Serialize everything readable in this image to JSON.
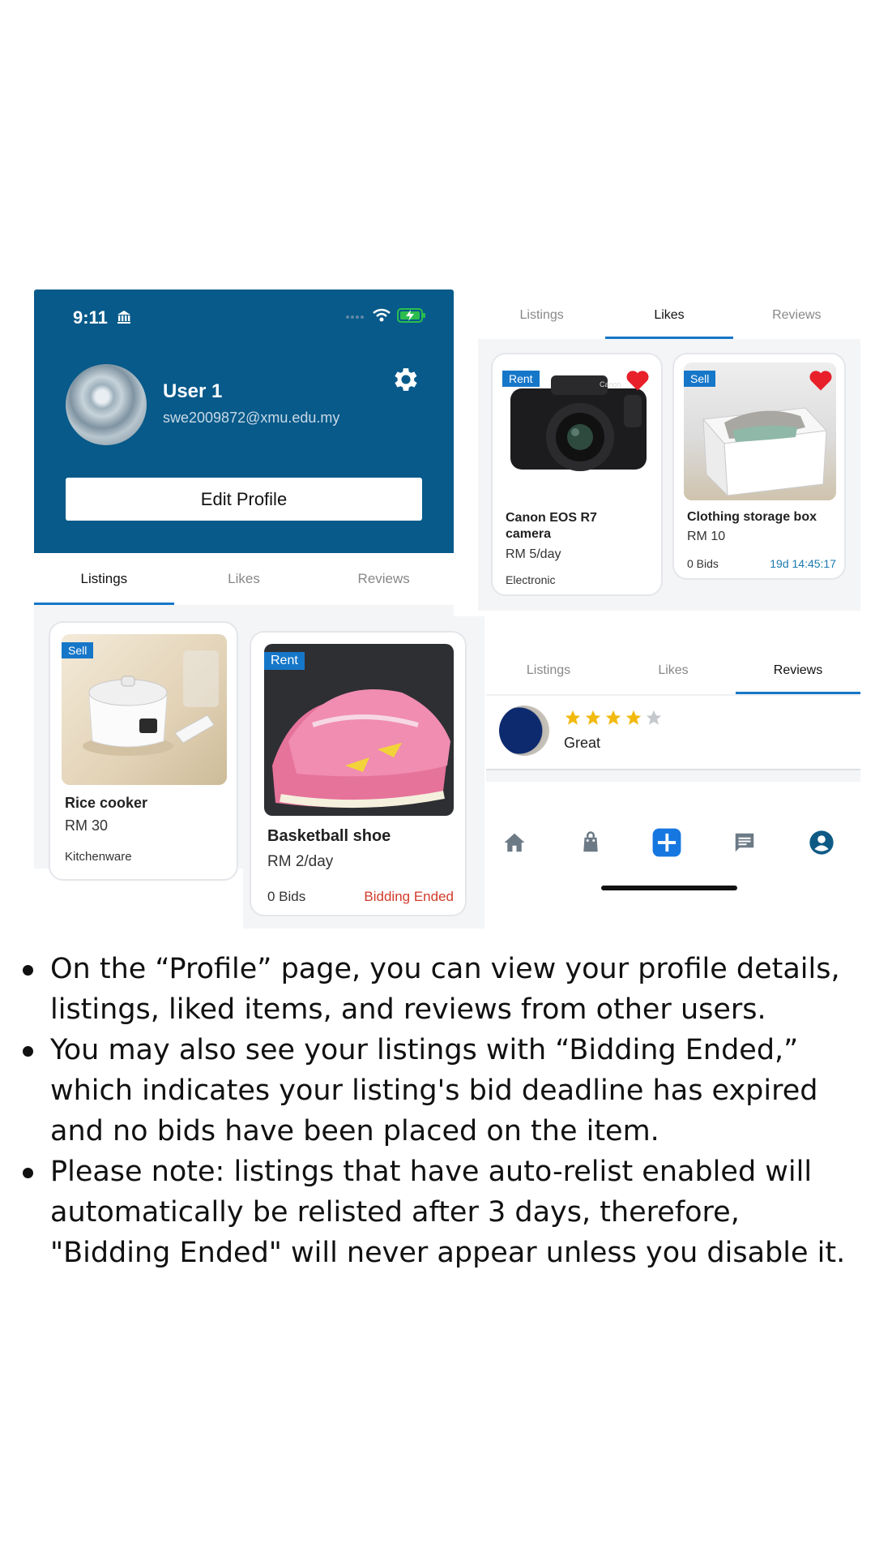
{
  "profile": {
    "status_time": "9:11",
    "user_name": "User 1",
    "user_email": "swe2009872@xmu.edu.my",
    "edit_profile_label": "Edit Profile"
  },
  "tabs": [
    "Listings",
    "Likes",
    "Reviews"
  ],
  "listings": [
    {
      "badge": "Sell",
      "title": "Rice cooker",
      "price": "RM 30",
      "category": "Kitchenware"
    },
    {
      "badge": "Rent",
      "title": "Basketball shoe",
      "price": "RM 2/day",
      "bids": "0 Bids",
      "status": "Bidding Ended"
    }
  ],
  "likes": [
    {
      "badge": "Rent",
      "title": "Canon EOS R7 camera",
      "price": "RM 5/day",
      "category": "Electronic"
    },
    {
      "badge": "Sell",
      "title": "Clothing storage box",
      "price": "RM 10",
      "bids": "0 Bids",
      "countdown": "19d 14:45:17"
    }
  ],
  "review": {
    "rating": 4,
    "max_rating": 5,
    "text": "Great"
  },
  "nav": [
    "home-icon",
    "bag-icon",
    "add-icon",
    "chat-icon",
    "profile-icon"
  ],
  "colors": {
    "header_bg": "#075a8a",
    "accent": "#1677c9",
    "bidding_ended": "#d23a2a",
    "countdown": "#1a7ab0",
    "star": "#f2b90f",
    "heart": "#e8202a"
  },
  "bullets": [
    "On the “Profile” page, you can view your profile details, listings, liked items, and reviews from other users.",
    "You may also see your listings with “Bidding Ended,” which indicates your listing's bid deadline has expired and no bids have been placed on the item.",
    "Please note: listings that have auto-relist enabled will automatically be relisted after 3 days, therefore, \"Bidding Ended\" will never appear unless you disable it."
  ]
}
